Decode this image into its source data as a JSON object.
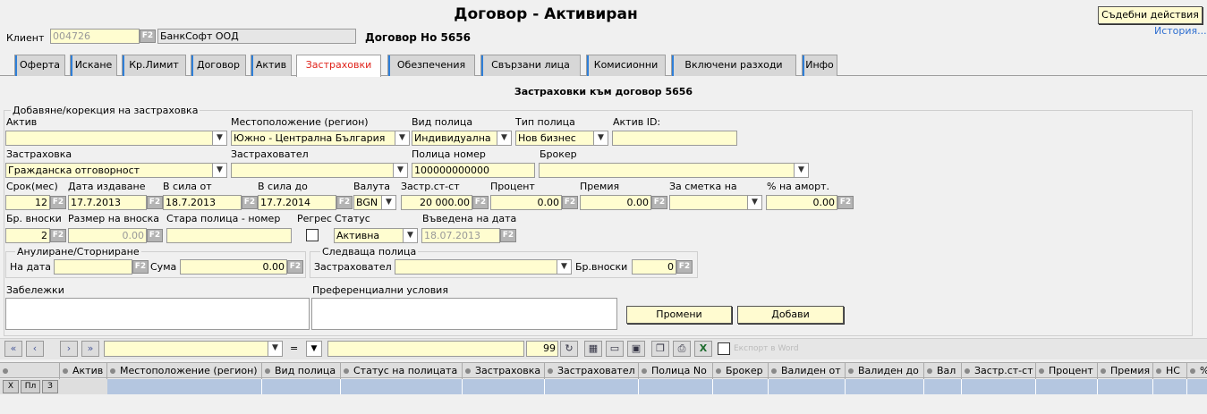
{
  "header": {
    "title": "Договор - Активиран",
    "legal_button": "Съдебни действия",
    "history_link": "История...",
    "client_label": "Клиент",
    "client_code": "004726",
    "client_name": "БанкСофт ООД",
    "contract_label": "Договор Но 5656"
  },
  "tabs": [
    {
      "label": "Оферта"
    },
    {
      "label": "Искане"
    },
    {
      "label": "Кр.Лимит"
    },
    {
      "label": "Договор"
    },
    {
      "label": "Актив"
    },
    {
      "label": "Застраховки"
    },
    {
      "label": "Обезпечения"
    },
    {
      "label": "Свързани лица"
    },
    {
      "label": "Комисионни"
    },
    {
      "label": "Включени разходи"
    },
    {
      "label": "Инфо"
    }
  ],
  "section_title": "Застраховки към договор 5656",
  "form": {
    "legend": "Добавяне/корекция на застраховка",
    "asset_label": "Актив",
    "asset_value": "",
    "location_label": "Местоположение (регион)",
    "location_value": "Южно - Централна България",
    "policy_kind_label": "Вид полица",
    "policy_kind_value": "Индивидуална",
    "policy_type_label": "Тип полица",
    "policy_type_value": "Нов бизнес",
    "asset_id_label": "Актив ID:",
    "asset_id_value": "",
    "insurance_label": "Застраховка",
    "insurance_value": "Гражданска отговорност",
    "insurer_label": "Застраховател",
    "insurer_value": "",
    "policy_no_label": "Полица номер",
    "policy_no_value": "100000000000",
    "broker_label": "Брокер",
    "broker_value": "",
    "term_label": "Срок(мес)",
    "term_value": "12",
    "issue_date_label": "Дата издаване",
    "issue_date_value": "17.7.2013",
    "valid_from_label": "В сила от",
    "valid_from_value": "18.7.2013",
    "valid_to_label": "В сила до",
    "valid_to_value": "17.7.2014",
    "currency_label": "Валута",
    "currency_value": "BGN",
    "ins_value_label": "Застр.ст-ст",
    "ins_value_value": "20 000.00",
    "percent_label": "Процент",
    "percent_value": "0.00",
    "premium_label": "Премия",
    "premium_value": "0.00",
    "account_label": "За сметка на",
    "account_value": "",
    "amort_label": "% на аморт.",
    "amort_value": "0.00",
    "installments_label": "Бр. вноски",
    "installments_value": "2",
    "inst_size_label": "Размер на вноска",
    "inst_size_value": "0.00",
    "old_policy_label": "Стара полица - номер",
    "old_policy_value": "",
    "regress_label": "Регрес",
    "status_label": "Статус",
    "status_value": "Активна",
    "entered_label": "Въведена на дата",
    "entered_value": "18.07.2013",
    "f2": "F2"
  },
  "cancel": {
    "legend": "Анулиране/Сторниране",
    "date_label": "На дата",
    "date_value": "",
    "sum_label": "Сума",
    "sum_value": "0.00"
  },
  "next_policy": {
    "legend": "Следваща полица",
    "insurer_label": "Застраховател",
    "insurer_value": "",
    "installments_label": "Бр.вноски",
    "installments_value": "0"
  },
  "notes_label": "Забележки",
  "pref_label": "Преференциални условия",
  "buttons": {
    "change": "Промени",
    "add": "Добави"
  },
  "toolbar": {
    "operator": "=",
    "page_size": "99",
    "word_label": "Експорт в Word"
  },
  "grid": {
    "columns": [
      "Актив",
      "Местоположение (регион)",
      "Вид полица",
      "Статус на полицата",
      "Застраховка",
      "Застраховател",
      "Полица No",
      "Брокер",
      "Валиден от",
      "Валиден до",
      "Вал",
      "Застр.ст-ст",
      "Процент",
      "Премия",
      "НС",
      "%"
    ],
    "row_buttons": [
      "X",
      "Пл",
      "З"
    ]
  },
  "colors": {
    "input_bg": "#fffdd0",
    "active_tab_text": "#e0231b",
    "grid_row": "#b4c6e0",
    "link": "#2f6fd0"
  }
}
